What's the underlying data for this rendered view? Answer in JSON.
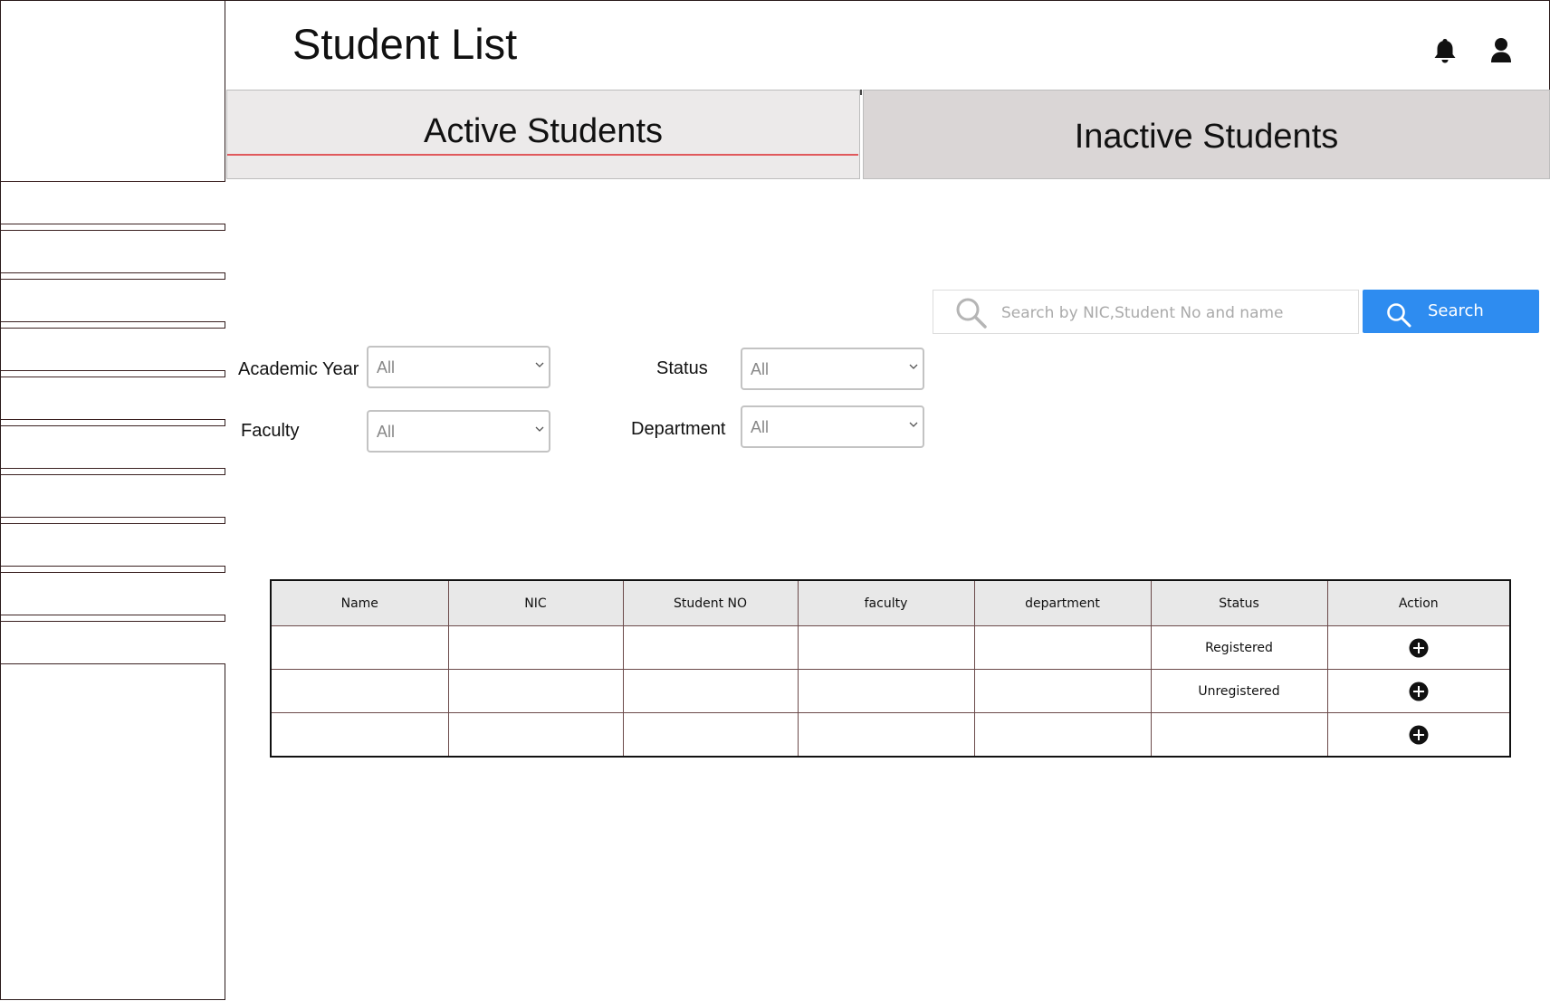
{
  "header": {
    "title": "Student List",
    "icons": [
      "bell-icon",
      "user-icon"
    ]
  },
  "sidebar": {
    "item_count": 10
  },
  "tabs": [
    {
      "label": "Active Students",
      "selected": true
    },
    {
      "label": "Inactive Students",
      "selected": false
    }
  ],
  "search": {
    "placeholder": "Search by NIC,Student No and name",
    "value": "",
    "button_label": "Search"
  },
  "filters": {
    "academic_year": {
      "label": "Academic Year",
      "value": "All"
    },
    "status": {
      "label": "Status",
      "value": "All"
    },
    "faculty": {
      "label": "Faculty",
      "value": "All"
    },
    "department": {
      "label": "Department",
      "value": "All"
    }
  },
  "table": {
    "columns": [
      "Name",
      "NIC",
      "Student NO",
      "faculty",
      "department",
      "Status",
      "Action"
    ],
    "rows": [
      {
        "name": "",
        "nic": "",
        "student_no": "",
        "faculty": "",
        "department": "",
        "status": "Registered"
      },
      {
        "name": "",
        "nic": "",
        "student_no": "",
        "faculty": "",
        "department": "",
        "status": "Unregistered"
      },
      {
        "name": "",
        "nic": "",
        "student_no": "",
        "faculty": "",
        "department": "",
        "status": ""
      }
    ]
  },
  "colors": {
    "accent": "#2e8cf0",
    "tab_underline": "#e0595c",
    "active_tab_bg": "#eceaea",
    "inactive_tab_bg": "#dad6d6"
  }
}
